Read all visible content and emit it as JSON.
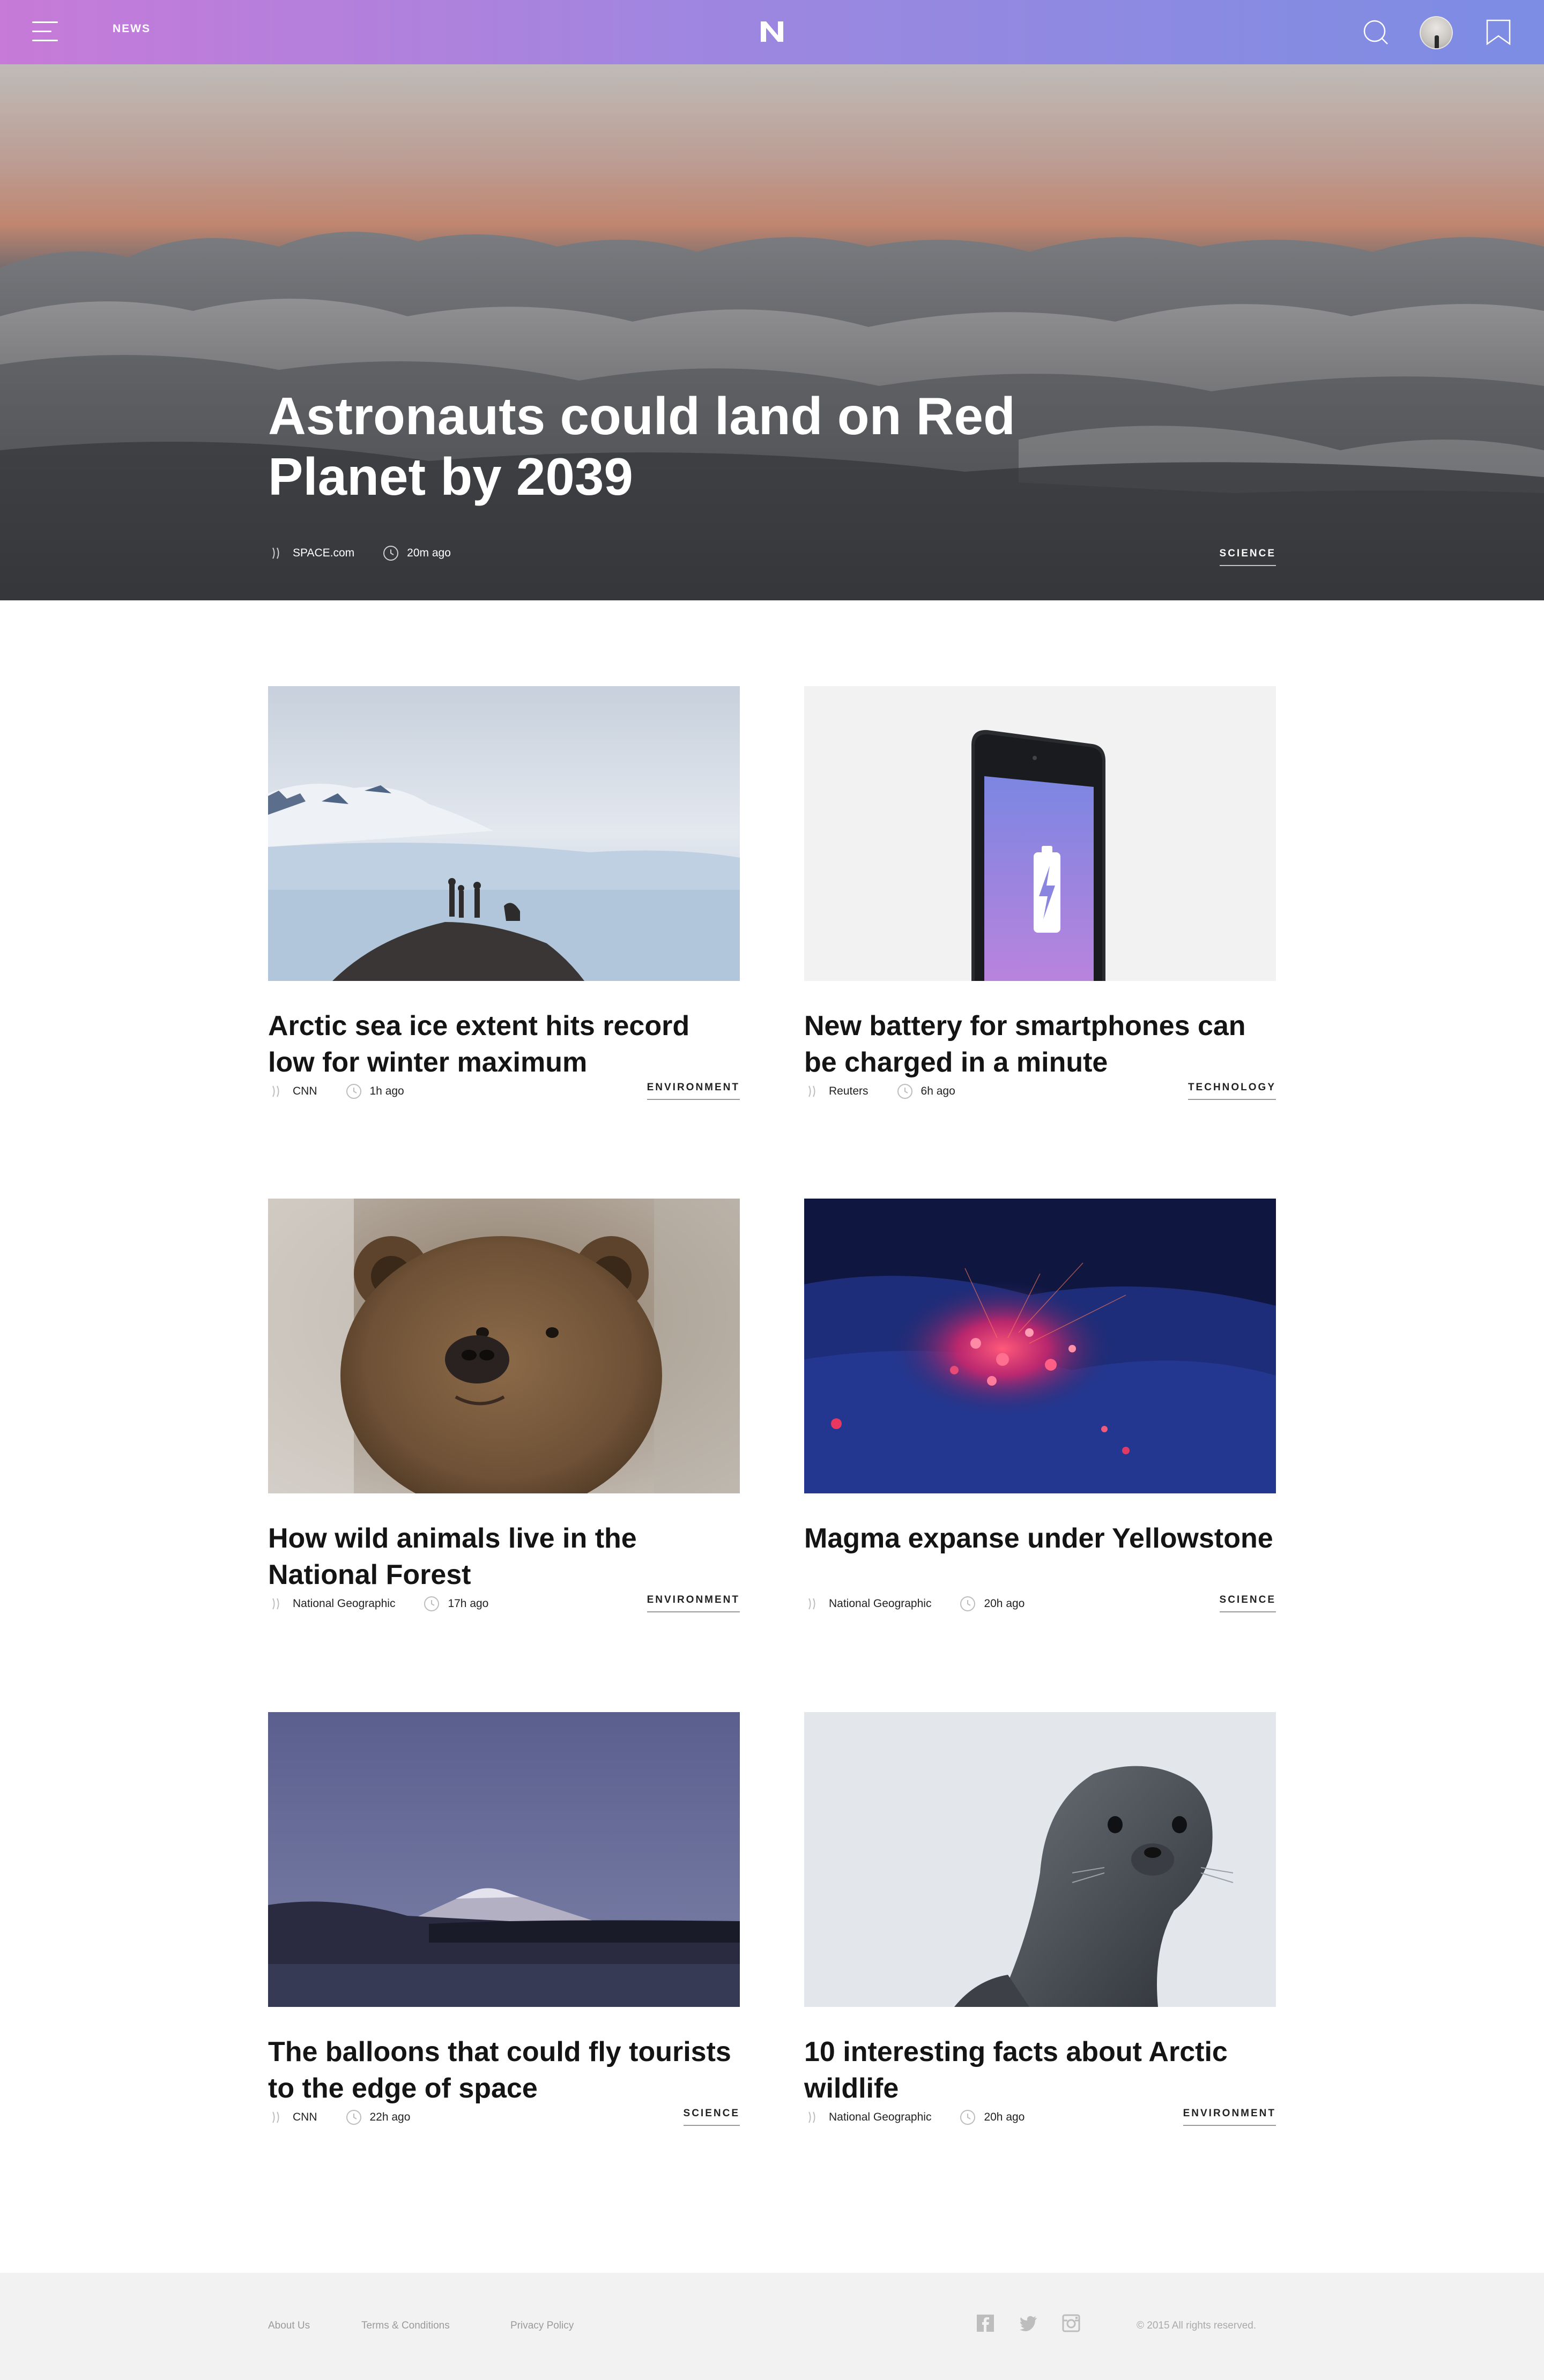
{
  "header": {
    "nav_label": "NEWS",
    "logo_text": "N",
    "gradient": [
      "#c77ad8",
      "#7c8de3"
    ]
  },
  "hero": {
    "title": "Astronauts could land on Red Planet by 2039",
    "source": "SPACE.com",
    "time": "20m ago",
    "category": "SCIENCE"
  },
  "articles": [
    {
      "title": "Arctic sea ice extent hits record low for winter maximum",
      "source": "CNN",
      "time": "1h ago",
      "category": "ENVIRONMENT",
      "image": "arctic-hikers-photo"
    },
    {
      "title": "New battery for smartphones can be charged in a minute",
      "source": "Reuters",
      "time": "6h ago",
      "category": "TECHNOLOGY",
      "image": "smartphone-battery-photo"
    },
    {
      "title": "How wild animals live in the National Forest",
      "source": "National Geographic",
      "time": "17h ago",
      "category": "ENVIRONMENT",
      "image": "brown-bear-photo"
    },
    {
      "title": "Magma expanse under Yellowstone",
      "source": "National Geographic",
      "time": "20h ago",
      "category": "SCIENCE",
      "image": "glowing-embers-photo"
    },
    {
      "title": "The balloons that could fly tourists to the edge of space",
      "source": "CNN",
      "time": "22h ago",
      "category": "SCIENCE",
      "image": "volcano-night-photo"
    },
    {
      "title": "10 interesting facts about Arctic wildlife",
      "source": "National Geographic",
      "time": "20h ago",
      "category": "ENVIRONMENT",
      "image": "seal-photo"
    }
  ],
  "footer": {
    "links": [
      "About Us",
      "Terms & Conditions",
      "Privacy Policy"
    ],
    "social": [
      "facebook-icon",
      "twitter-icon",
      "instagram-icon"
    ],
    "copyright": "© 2015 All rights reserved."
  }
}
